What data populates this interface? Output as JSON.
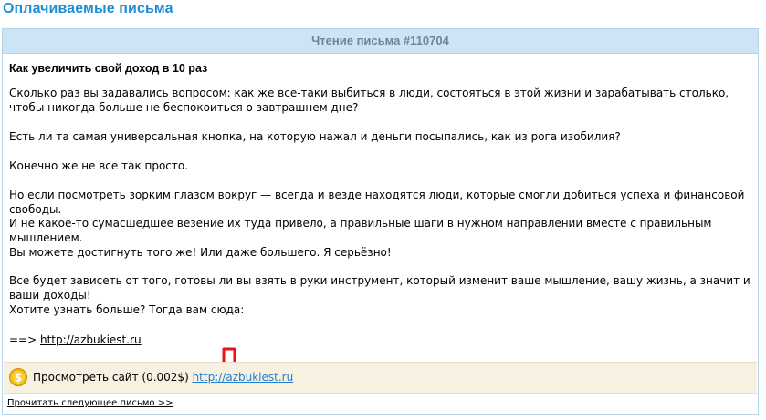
{
  "page": {
    "title": "Оплачиваемые письма"
  },
  "letter": {
    "header": "Чтение письма #110704",
    "subject": "Как увеличить свой доход в 10 раз",
    "paragraphs": [
      "Сколько раз вы задавались вопросом: как же все-таки выбиться в люди, состояться в этой жизни и зарабатывать столько, чтобы никогда больше не беспокоиться о завтрашнем дне?",
      "Есть ли та самая универсальная кнопка, на которую нажал и деньги посыпались, как из рога изобилия?",
      "Конечно же не все так просто.",
      "Но если посмотреть зорким глазом вокруг — всегда и везде находятся люди, которые смогли добиться успеха и финансовой свободы.",
      "И не какое-то сумасшедшее везение их туда привело, а правильные шаги в нужном направлении вместе с правильным мышлением.",
      "Вы можете достигнуть того же! Или даже большего. Я серьёзно!",
      "Все будет зависеть от того, готовы ли вы взять в руки инструмент, который изменит ваше мышление, вашу жизнь, а значит и ваши доходы!",
      "Хотите узнать больше? Тогда вам сюда:"
    ],
    "link_prefix": "==>",
    "link_text": "http://azbukiest.ru"
  },
  "visit": {
    "label": "Просмотреть сайт (0.002$)",
    "link_text": "http://azbukiest.ru",
    "coin_glyph": "$"
  },
  "footer": {
    "next_label": "Прочитать следующее письмо >>"
  },
  "colors": {
    "title": "#1e8ed6",
    "header_bg": "#cce4f6",
    "header_text": "#6f8494",
    "visit_bg": "#f7f1e1",
    "arrow": "#e8141b",
    "coin": "#f0b90b",
    "visit_link": "#1e7fd0"
  }
}
